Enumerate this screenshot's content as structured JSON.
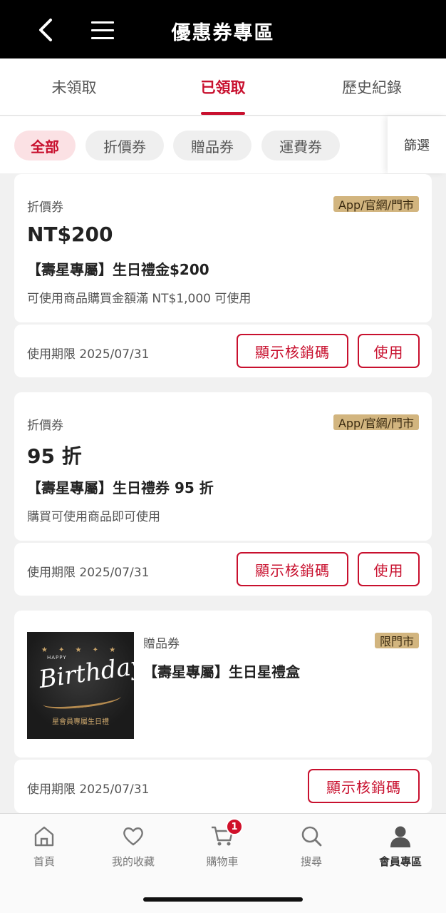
{
  "header": {
    "title": "優惠券專區"
  },
  "tabs": [
    {
      "label": "未領取",
      "active": false
    },
    {
      "label": "已領取",
      "active": true
    },
    {
      "label": "歷史紀錄",
      "active": false
    }
  ],
  "chips": [
    {
      "label": "全部",
      "active": true
    },
    {
      "label": "折價券",
      "active": false
    },
    {
      "label": "贈品券",
      "active": false
    },
    {
      "label": "運費券",
      "active": false
    }
  ],
  "filter_label": "篩選",
  "coupons": [
    {
      "type": "折價券",
      "channel": "App/官網/門市",
      "amount": "NT$200",
      "name": "【壽星專屬】生日禮金$200",
      "desc": "可使用商品購買金額滿 NT$1,000 可使用",
      "expiry": "使用期限 2025/07/31",
      "show_code_label": "顯示核銷碼",
      "use_label": "使用"
    },
    {
      "type": "折價券",
      "channel": "App/官網/門市",
      "amount": "95 折",
      "name": "【壽星專屬】生日禮券 95 折",
      "desc": "購買可使用商品即可使用",
      "expiry": "使用期限 2025/07/31",
      "show_code_label": "顯示核銷碼",
      "use_label": "使用"
    },
    {
      "type": "贈品券",
      "channel": "限門市",
      "name": "【壽星專屬】生日星禮盒",
      "image": {
        "happy": "HAPPY",
        "title": "Birthday!",
        "caption": "星會員專屬生日禮"
      },
      "expiry": "使用期限 2025/07/31",
      "show_code_label": "顯示核銷碼"
    }
  ],
  "bottom_nav": [
    {
      "label": "首頁",
      "icon": "home-icon"
    },
    {
      "label": "我的收藏",
      "icon": "heart-icon"
    },
    {
      "label": "購物車",
      "icon": "cart-icon",
      "badge": "1"
    },
    {
      "label": "搜尋",
      "icon": "search-icon"
    },
    {
      "label": "會員專區",
      "icon": "member-icon",
      "active": true
    }
  ],
  "colors": {
    "accent": "#c8102e",
    "badge_gold": "#d2b57f",
    "topbar": "#000000"
  }
}
